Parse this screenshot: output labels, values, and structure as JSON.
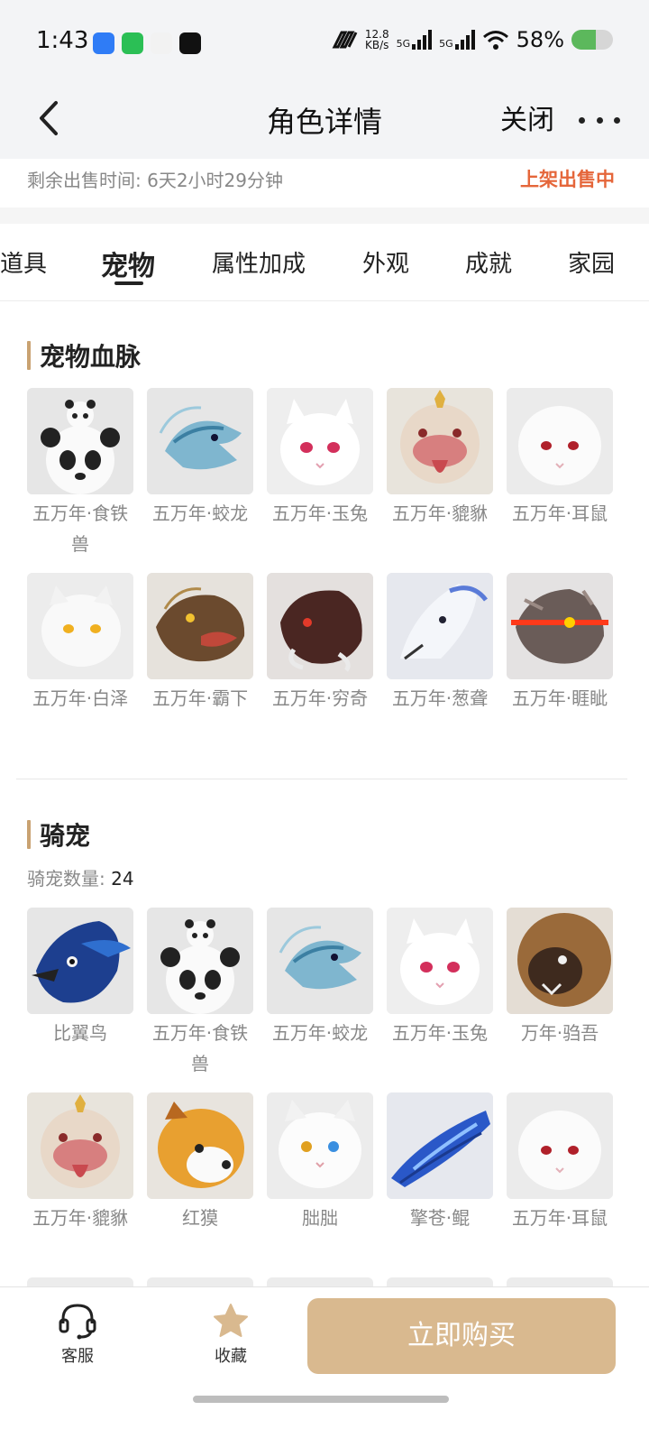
{
  "status_bar": {
    "time": "1:43",
    "net_speed_value": "12.8",
    "net_speed_unit": "KB/s",
    "signal_1": "5G",
    "signal_2": "5G",
    "battery": "58%",
    "battery_level": 0.58,
    "app_icons": [
      {
        "name": "blue-app-icon",
        "color": "#2f7cf6"
      },
      {
        "name": "wechat-icon",
        "color": "#2bbf55"
      },
      {
        "name": "compass-app-icon",
        "color": "#f2f2f2"
      },
      {
        "name": "tiktok-icon",
        "color": "#111111"
      }
    ]
  },
  "nav": {
    "title": "角色详情",
    "close": "关闭"
  },
  "sale": {
    "remaining": "剩余出售时间: 6天2小时29分钟",
    "status": "上架出售中"
  },
  "tabs": [
    {
      "label": "道具"
    },
    {
      "label": "宠物",
      "active": true
    },
    {
      "label": "属性加成"
    },
    {
      "label": "外观"
    },
    {
      "label": "成就"
    },
    {
      "label": "家园"
    }
  ],
  "bloodline": {
    "title": "宠物血脉",
    "items": [
      {
        "label": "五万年·食铁兽",
        "icon": "panda-icon"
      },
      {
        "label": "五万年·蛟龙",
        "icon": "dragon-icon"
      },
      {
        "label": "五万年·玉兔",
        "icon": "rabbit-icon"
      },
      {
        "label": "五万年·貔貅",
        "icon": "pixiu-icon"
      },
      {
        "label": "五万年·耳鼠",
        "icon": "white-mouse-icon"
      },
      {
        "label": "五万年·白泽",
        "icon": "white-cat-icon"
      },
      {
        "label": "五万年·霸下",
        "icon": "dragon-turtle-icon"
      },
      {
        "label": "五万年·穷奇",
        "icon": "boar-icon"
      },
      {
        "label": "五万年·葱聋",
        "icon": "wolf-icon"
      },
      {
        "label": "五万年·睚眦",
        "icon": "red-eye-beast-icon"
      }
    ]
  },
  "mounts": {
    "title": "骑宠",
    "count_label": "骑宠数量:",
    "count": "24",
    "items": [
      {
        "label": "比翼鸟",
        "icon": "bird-icon"
      },
      {
        "label": "五万年·食铁兽",
        "icon": "panda-icon"
      },
      {
        "label": "五万年·蛟龙",
        "icon": "dragon-icon"
      },
      {
        "label": "五万年·玉兔",
        "icon": "rabbit-icon"
      },
      {
        "label": "万年·驺吾",
        "icon": "lion-icon"
      },
      {
        "label": "五万年·貔貅",
        "icon": "pixiu-icon"
      },
      {
        "label": "红獏",
        "icon": "red-panda-icon"
      },
      {
        "label": "朏朏",
        "icon": "fluffy-cat-icon"
      },
      {
        "label": "擎苍·鲲",
        "icon": "blue-fish-icon"
      },
      {
        "label": "五万年·耳鼠",
        "icon": "white-mouse-icon"
      }
    ]
  },
  "bottom": {
    "service": "客服",
    "favorite": "收藏",
    "buy": "立即购买"
  }
}
